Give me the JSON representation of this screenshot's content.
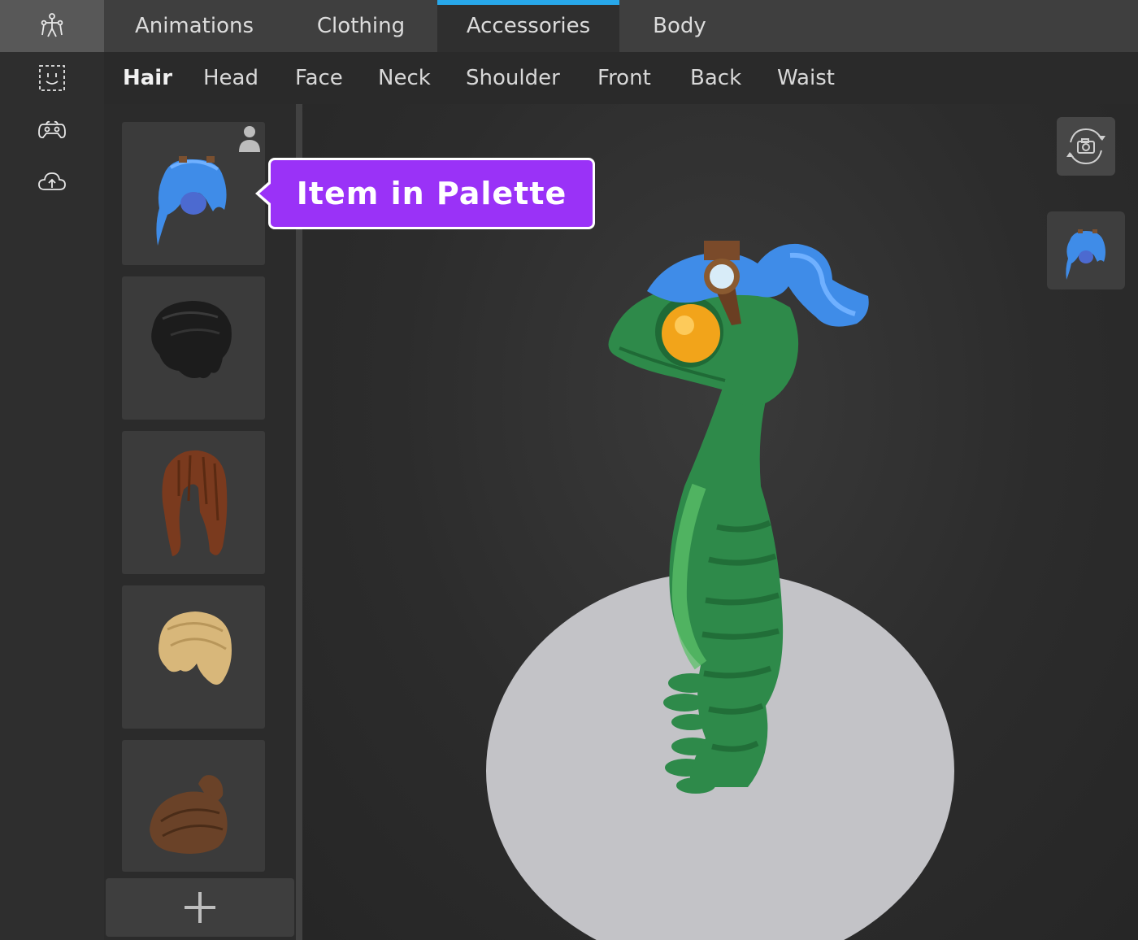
{
  "rail": {
    "icons": [
      "rig-icon",
      "face-icon",
      "gamepad-icon",
      "cloud-upload-icon"
    ],
    "active_index": 0
  },
  "tabs": [
    {
      "label": "Animations",
      "active": false
    },
    {
      "label": "Clothing",
      "active": false
    },
    {
      "label": "Accessories",
      "active": true
    },
    {
      "label": "Body",
      "active": false
    }
  ],
  "subtabs": [
    {
      "label": "Hair",
      "active": true
    },
    {
      "label": "Head",
      "active": false
    },
    {
      "label": "Face",
      "active": false
    },
    {
      "label": "Neck",
      "active": false
    },
    {
      "label": "Shoulder",
      "active": false
    },
    {
      "label": "Front",
      "active": false
    },
    {
      "label": "Back",
      "active": false
    },
    {
      "label": "Waist",
      "active": false
    }
  ],
  "palette": {
    "items": [
      {
        "name": "blue-hair-with-goggles",
        "color": "#3f8ce8",
        "equipped": true
      },
      {
        "name": "black-hair",
        "color": "#1e1e1e",
        "equipped": false
      },
      {
        "name": "brown-long-hair",
        "color": "#7a3a1e",
        "equipped": false
      },
      {
        "name": "blonde-hair",
        "color": "#d8b77a",
        "equipped": false
      },
      {
        "name": "brown-bun-hair",
        "color": "#6a4228",
        "equipped": false
      }
    ],
    "add_icon": "plus-icon"
  },
  "callout": {
    "text": "Item in Palette",
    "color": "#9a32f7"
  },
  "viewport": {
    "camera_icon": "rotate-camera-icon",
    "equipped_item": "blue-hair-with-goggles"
  },
  "colors": {
    "accent": "#28a8ea",
    "avatar_green": "#2e8a4a",
    "platform": "#c3c3c7"
  }
}
